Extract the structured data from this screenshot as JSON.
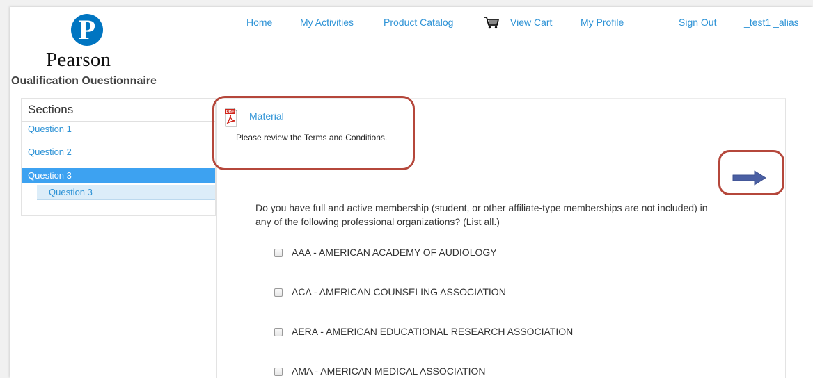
{
  "brand": {
    "logo_letter": "P",
    "logo_word": "Pearson"
  },
  "nav": {
    "home": "Home",
    "my_activities": "My Activities",
    "product_catalog": "Product Catalog",
    "view_cart": "View Cart",
    "my_profile": "My Profile",
    "sign_out": "Sign Out",
    "user": "_test1 _alias"
  },
  "page_title": "Qualification Questionnaire",
  "sections": {
    "heading": "Sections",
    "items": [
      {
        "label": "Question 1"
      },
      {
        "label": "Question 2"
      },
      {
        "label": "Question 3",
        "active": true
      }
    ],
    "sub_item": "Question 3"
  },
  "material": {
    "link": "Material",
    "description": "Please review the Terms and Conditions."
  },
  "question": {
    "text": "Do you have full and active membership (student, or other affiliate-type memberships are not included) in any of the following professional organizations? (List all.)",
    "options": [
      "AAA - AMERICAN ACADEMY OF AUDIOLOGY",
      "ACA - AMERICAN COUNSELING ASSOCIATION",
      "AERA - AMERICAN EDUCATIONAL RESEARCH ASSOCIATION",
      "AMA - AMERICAN MEDICAL ASSOCIATION"
    ]
  },
  "colors": {
    "link": "#2e93d6",
    "brand_blue": "#0075c1",
    "active_section": "#3da2f1",
    "highlight_box": "#b5473b",
    "arrow": "#4a5fa3"
  },
  "icons": {
    "cart": "cart-icon",
    "pdf": "pdf-icon",
    "next": "right-arrow-icon"
  }
}
